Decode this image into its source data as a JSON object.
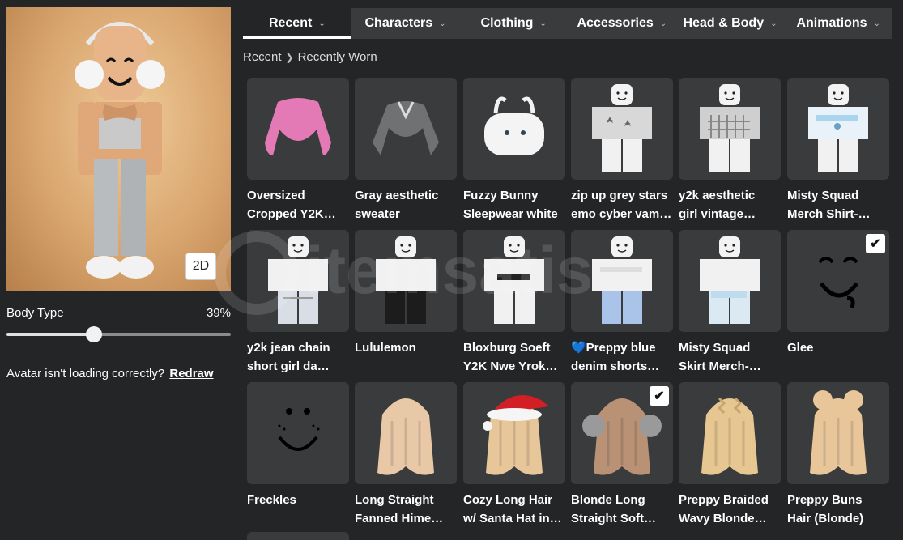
{
  "avatar": {
    "toggle_label": "2D",
    "body_type_label": "Body Type",
    "body_type_value": "39%",
    "body_type_fraction": 0.39,
    "loading_message": "Avatar isn't loading correctly?",
    "redraw_label": "Redraw"
  },
  "tabs": [
    {
      "label": "Recent",
      "active": true
    },
    {
      "label": "Characters",
      "active": false
    },
    {
      "label": "Clothing",
      "active": false
    },
    {
      "label": "Accessories",
      "active": false
    },
    {
      "label": "Head & Body",
      "active": false
    },
    {
      "label": "Animations",
      "active": false
    }
  ],
  "breadcrumb": {
    "root": "Recent",
    "current": "Recently Worn"
  },
  "items": [
    {
      "name": "Oversized\nCropped Y2K…",
      "thumb": "pink-hoodie",
      "worn": false
    },
    {
      "name": "Gray aesthetic\nsweater",
      "thumb": "gray-sweater",
      "worn": false
    },
    {
      "name": "Fuzzy Bunny\nSleepwear white",
      "thumb": "bunny-bag",
      "worn": false
    },
    {
      "name": "zip up grey stars\nemo cyber vam…",
      "thumb": "figure-stars",
      "worn": false
    },
    {
      "name": "y2k aesthetic\ngirl vintage…",
      "thumb": "figure-plaid",
      "worn": false
    },
    {
      "name": "Misty Squad\nMerch Shirt-…",
      "thumb": "figure-blue-shirt",
      "worn": false
    },
    {
      "name": "y2k jean chain\nshort girl da…",
      "thumb": "figure-jean-shorts",
      "worn": false
    },
    {
      "name": "Lululemon",
      "thumb": "figure-black-shorts",
      "worn": false
    },
    {
      "name": "Bloxburg Soeft\nY2K Nwe Yrok…",
      "thumb": "figure-ny-shirt",
      "worn": false
    },
    {
      "name": "💙Preppy blue\ndenim shorts…",
      "thumb": "figure-denim-shorts",
      "worn": false
    },
    {
      "name": "Misty Squad\nSkirt Merch-…",
      "thumb": "figure-skirt",
      "worn": false
    },
    {
      "name": "Glee",
      "thumb": "face-glee",
      "worn": true
    },
    {
      "name": "Freckles",
      "thumb": "face-freckles",
      "worn": false
    },
    {
      "name": "Long Straight\nFanned Hime…",
      "thumb": "hair-straight",
      "worn": false
    },
    {
      "name": "Cozy Long Hair\nw/ Santa Hat in…",
      "thumb": "hair-santa",
      "worn": false
    },
    {
      "name": "Blonde Long\nStraight Soft…",
      "thumb": "hair-earmuffs",
      "worn": true
    },
    {
      "name": "Preppy Braided\nWavy Blonde…",
      "thumb": "hair-braided",
      "worn": false
    },
    {
      "name": "Preppy Buns\nHair (Blonde)",
      "thumb": "hair-buns",
      "worn": false
    }
  ],
  "colors": {
    "background": "#232527",
    "tile": "#393b3d",
    "tab_bar": "#393b3d",
    "text": "#ffffff"
  }
}
